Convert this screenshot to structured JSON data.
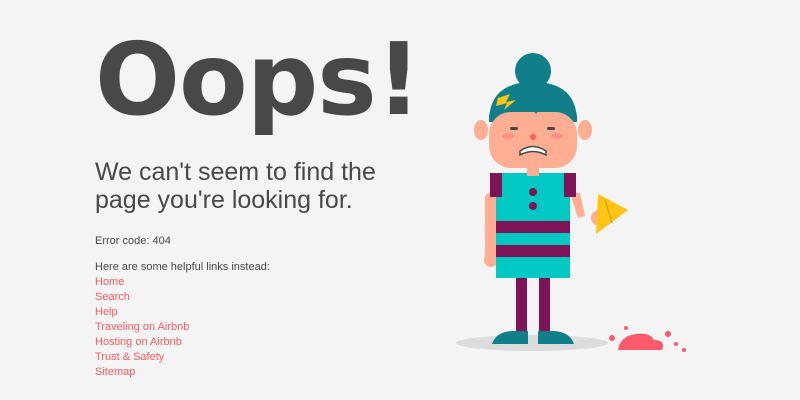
{
  "page": {
    "headline": "Oops!",
    "subheading": "We can't seem to find the page you're looking for.",
    "error_code": "Error code: 404",
    "helpful_intro": "Here are some helpful links instead:"
  },
  "links": [
    {
      "label": "Home"
    },
    {
      "label": "Search"
    },
    {
      "label": "Help"
    },
    {
      "label": "Traveling on Airbnb"
    },
    {
      "label": "Hosting on Airbnb"
    },
    {
      "label": "Trust & Safety"
    },
    {
      "label": "Sitemap"
    }
  ],
  "colors": {
    "background": "#f4f4f4",
    "text": "#484848",
    "link": "#ff5a5f",
    "hair": "#117f8a",
    "dress_teal": "#00c9c3",
    "dress_purple": "#7d1457",
    "skin": "#ffae94",
    "ice_cream": "#ff5a6b",
    "cone": "#ffc414"
  },
  "illustration": {
    "icon": "girl-with-dropped-ice-cream-icon"
  }
}
